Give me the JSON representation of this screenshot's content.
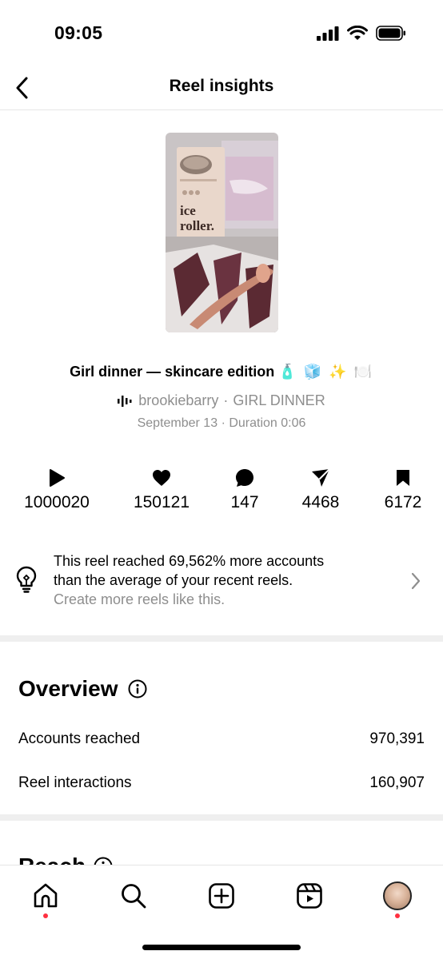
{
  "status_bar": {
    "time": "09:05"
  },
  "nav": {
    "title": "Reel insights"
  },
  "reel": {
    "title": "Girl dinner — skincare edition",
    "title_emoji": "🧴 🧊 ✨ 🍽️",
    "audio_user": "brookiebarry",
    "audio_separator": "·",
    "audio_name": "GIRL DINNER",
    "date": "September 13",
    "meta_separator": "·",
    "duration": "Duration 0:06"
  },
  "metrics": {
    "plays": "1000020",
    "likes": "150121",
    "comments": "147",
    "shares": "4468",
    "saves": "6172"
  },
  "tip": {
    "line1": "This reel reached 69,562% more accounts",
    "line2": "than the average of your recent reels.",
    "line3": "Create more reels like this."
  },
  "overview": {
    "title": "Overview",
    "rows": [
      {
        "label": "Accounts reached",
        "value": "970,391"
      },
      {
        "label": "Reel interactions",
        "value": "160,907"
      }
    ]
  },
  "reach": {
    "title": "Reach"
  },
  "icons": {
    "back": "chevron-left-icon",
    "play": "play-icon",
    "like": "heart-icon",
    "comment": "comment-icon",
    "share": "send-icon",
    "save": "bookmark-icon",
    "tip": "lightbulb-icon",
    "info": "info-icon",
    "tabs": [
      "home-icon",
      "search-icon",
      "create-icon",
      "reels-icon",
      "profile-avatar"
    ]
  },
  "colors": {
    "notification_dot": "#ff3040",
    "secondary_text": "#8e8e8e",
    "divider": "#efefef"
  }
}
